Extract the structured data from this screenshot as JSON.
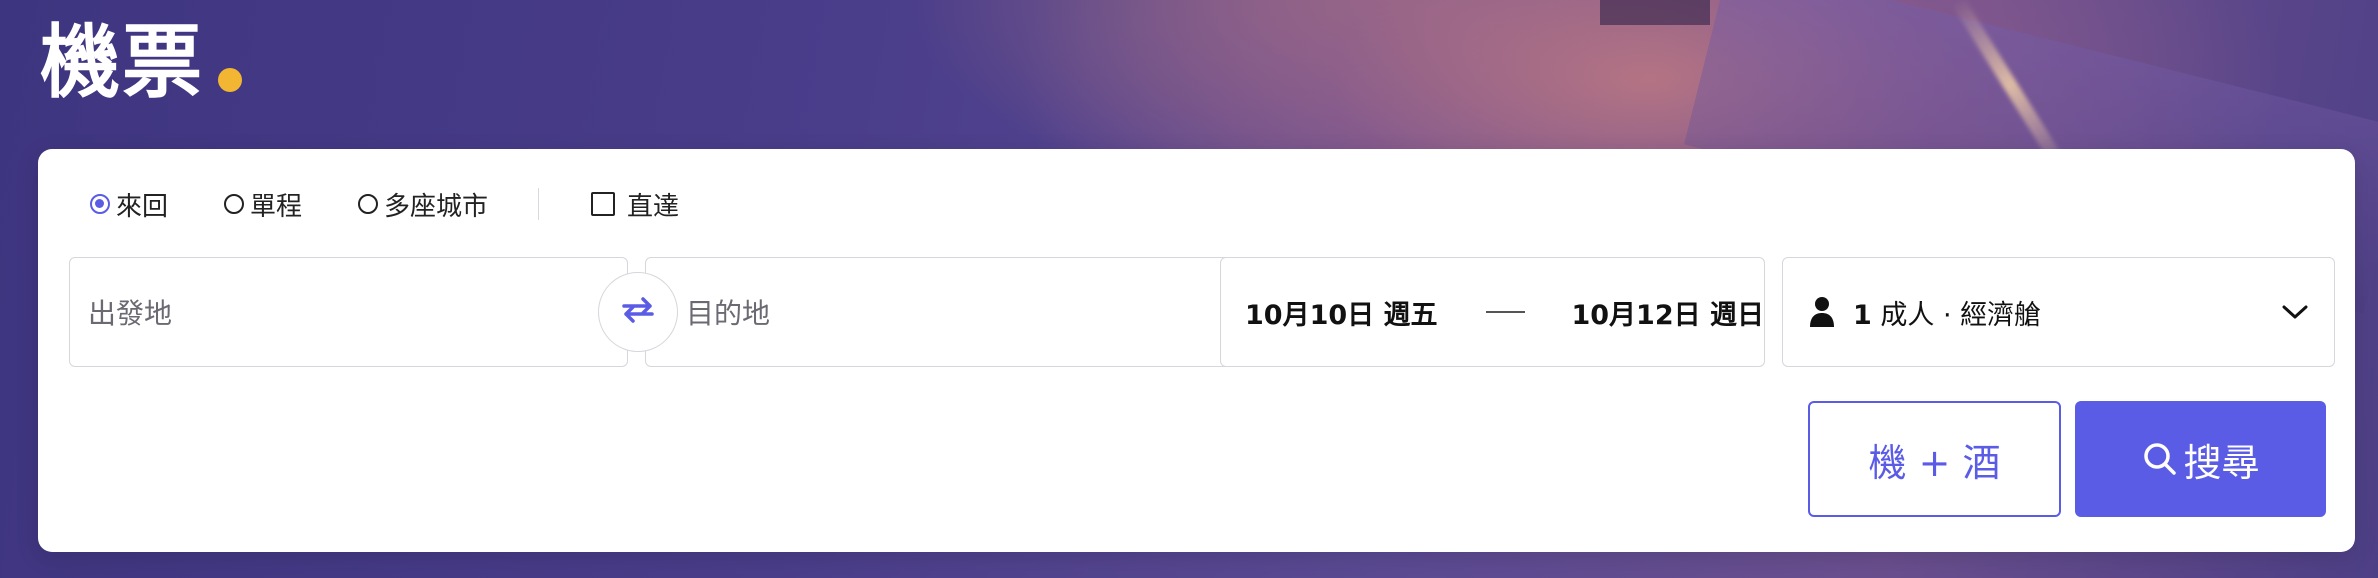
{
  "header": {
    "title": "機票"
  },
  "trip_types": [
    {
      "label": "來回",
      "selected": true
    },
    {
      "label": "單程",
      "selected": false
    },
    {
      "label": "多座城市",
      "selected": false
    }
  ],
  "direct_only": {
    "label": "直達",
    "checked": false
  },
  "origin": {
    "placeholder": "出發地"
  },
  "destination": {
    "placeholder": "目的地"
  },
  "dates": {
    "depart": "10月10日 週五",
    "return": "10月12日 週日"
  },
  "passengers": {
    "count": "1",
    "description": "成人 · 經濟艙"
  },
  "actions": {
    "package_label": "機 + 酒",
    "search_label": "搜尋"
  },
  "icons": {
    "swap": "swap-arrows-icon",
    "person": "person-icon",
    "chevron": "chevron-down-icon",
    "search": "search-icon"
  },
  "colors": {
    "accent": "#5b5ce6",
    "title_dot": "#f2b632",
    "background": "#4a3d8a"
  }
}
